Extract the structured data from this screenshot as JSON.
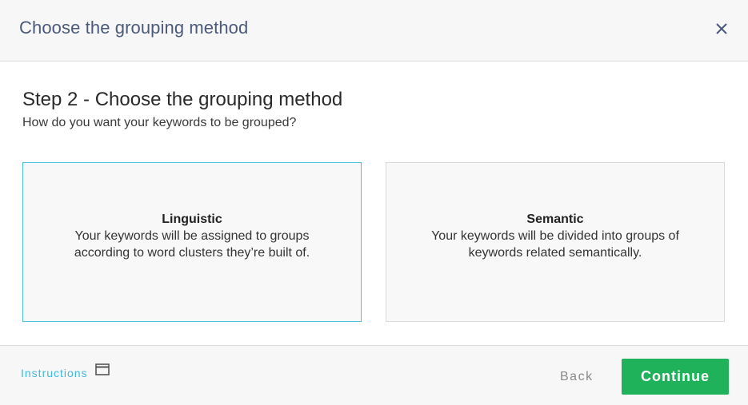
{
  "header": {
    "title": "Choose the grouping method",
    "close_icon": "close-icon"
  },
  "step": {
    "title": "Step 2 - Choose the grouping method",
    "subtitle": "How do you want your keywords to be grouped?"
  },
  "options": [
    {
      "title": "Linguistic",
      "description": "Your keywords will be assigned to groups according to word clusters they’re built of.",
      "selected": true
    },
    {
      "title": "Semantic",
      "description": "Your keywords will be divided into groups of keywords related semantically.",
      "selected": false
    }
  ],
  "footer": {
    "instructions_label": "Instructions",
    "instructions_icon": "window-icon",
    "back_label": "Back",
    "continue_label": "Continue"
  },
  "colors": {
    "accent": "#4ec3e0",
    "continue": "#1fb25a",
    "header_title": "#4a5a78"
  }
}
